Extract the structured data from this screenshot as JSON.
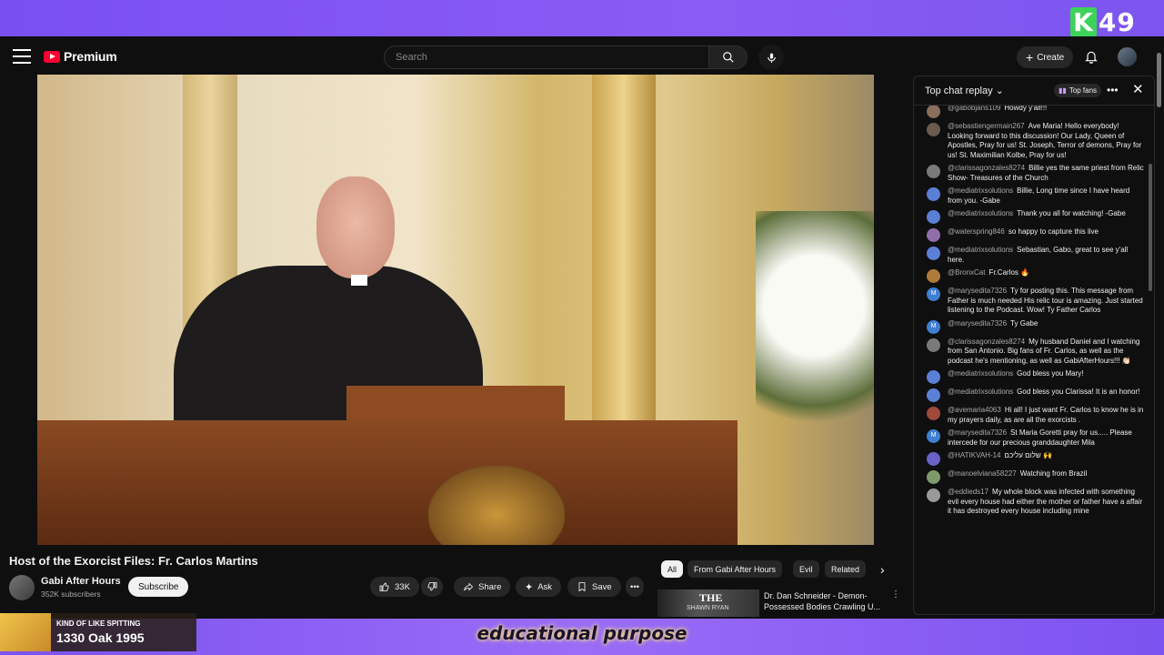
{
  "overlay": {
    "channel_badge": "49",
    "badge_letter": "K",
    "now_playing": {
      "subtitle": "KIND OF LIKE SPITTING",
      "title": "1330 Oak 1995"
    },
    "caption": "educational purpose"
  },
  "masthead": {
    "brand": "Premium",
    "search_placeholder": "Search",
    "create_label": "Create"
  },
  "video": {
    "title": "Host of the Exorcist Files: Fr. Carlos Martins",
    "channel": "Gabi After Hours",
    "subscribers": "352K subscribers",
    "subscribe_label": "Subscribe",
    "likes": "33K",
    "share_label": "Share",
    "ask_label": "Ask",
    "save_label": "Save"
  },
  "chips": [
    "All",
    "From Gabi After Hours",
    "Evil",
    "Related"
  ],
  "recommendation": {
    "thumb_text": "THE",
    "thumb_sub": "SHAWN RYAN",
    "title": "Dr. Dan Schneider - Demon-Possessed Bodies Crawling U..."
  },
  "chat": {
    "mode": "Top chat replay",
    "top_fans": "Top fans",
    "messages": [
      {
        "author": "@gabobjans109",
        "text": "Howdy y'all!!!",
        "color": "#8a6d5a"
      },
      {
        "author": "@sebastiengermain267",
        "text": "Ave Maria! Hello everybody! Looking forward to this discussion! Our Lady, Queen of Apostles, Pray for us! St. Joseph, Terror of demons, Pray for us! St. Maximilian Kolbe, Pray for us!",
        "color": "#6b5a4e"
      },
      {
        "author": "@clarissagonzales8274",
        "text": "Billie yes the same priest from Relic Show- Treasures of the Church",
        "color": "#7a7a7a"
      },
      {
        "author": "@mediatrixsolutions",
        "text": "Billie, Long time since I have heard from you. -Gabe",
        "color": "#5b7fd6"
      },
      {
        "author": "@mediatrixsolutions",
        "text": "Thank you all for watching! -Gabe",
        "color": "#5b7fd6"
      },
      {
        "author": "@waterspring846",
        "text": "so happy to capture this live",
        "color": "#8e6fa8"
      },
      {
        "author": "@mediatrixsolutions",
        "text": "Sebastian, Gabo, great to see y'all here.",
        "color": "#5b7fd6"
      },
      {
        "author": "@BronxCat",
        "text": "Fr.Carlos 🔥",
        "color": "#b07a3a"
      },
      {
        "author": "@marysedita7326",
        "text": "Ty for posting this. This message from Father is much needed His relic tour is amazing. Just started listening to the Podcast. Wow! Ty Father Carlos",
        "color": "#3f7fd1",
        "initial": "M"
      },
      {
        "author": "@marysedita7326",
        "text": "Ty Gabe",
        "color": "#3f7fd1",
        "initial": "M"
      },
      {
        "author": "@clarissagonzales8274",
        "text": "My husband Daniel and I watching from San Antonio. Big fans of Fr. Carlos, as well as the podcast he's mentioning, as well as GabiAfterHours!!! 👏🏻",
        "color": "#7a7a7a"
      },
      {
        "author": "@mediatrixsolutions",
        "text": "God bless you Mary!",
        "color": "#5b7fd6"
      },
      {
        "author": "@mediatrixsolutions",
        "text": "God bless you Clarissa! It is an honor!",
        "color": "#5b7fd6"
      },
      {
        "author": "@avemaria4063",
        "text": "Hi all! I just want Fr. Carlos to know he is in my prayers daily, as are all the exorcists .",
        "color": "#a0483a"
      },
      {
        "author": "@marysedita7326",
        "text": "St Maria Goretti pray for us..... Please intercede for our precious granddaughter Mila",
        "color": "#3f7fd1",
        "initial": "M"
      },
      {
        "author": "@HATIKVAH-14",
        "text": "שלום עליכם 🙌",
        "color": "#6a62c8"
      },
      {
        "author": "@manoelviana58227",
        "text": "Watching from Brazil",
        "color": "#7f9a6a"
      },
      {
        "author": "@eddieds17",
        "text": "My whole block was infected with something evil every house had either the mother or father have a affair it has destroyed every house including mine",
        "color": "#999999"
      }
    ]
  },
  "colors": {
    "accent_red": "#ff0033",
    "overlay_purple": "#7b5cf0"
  }
}
